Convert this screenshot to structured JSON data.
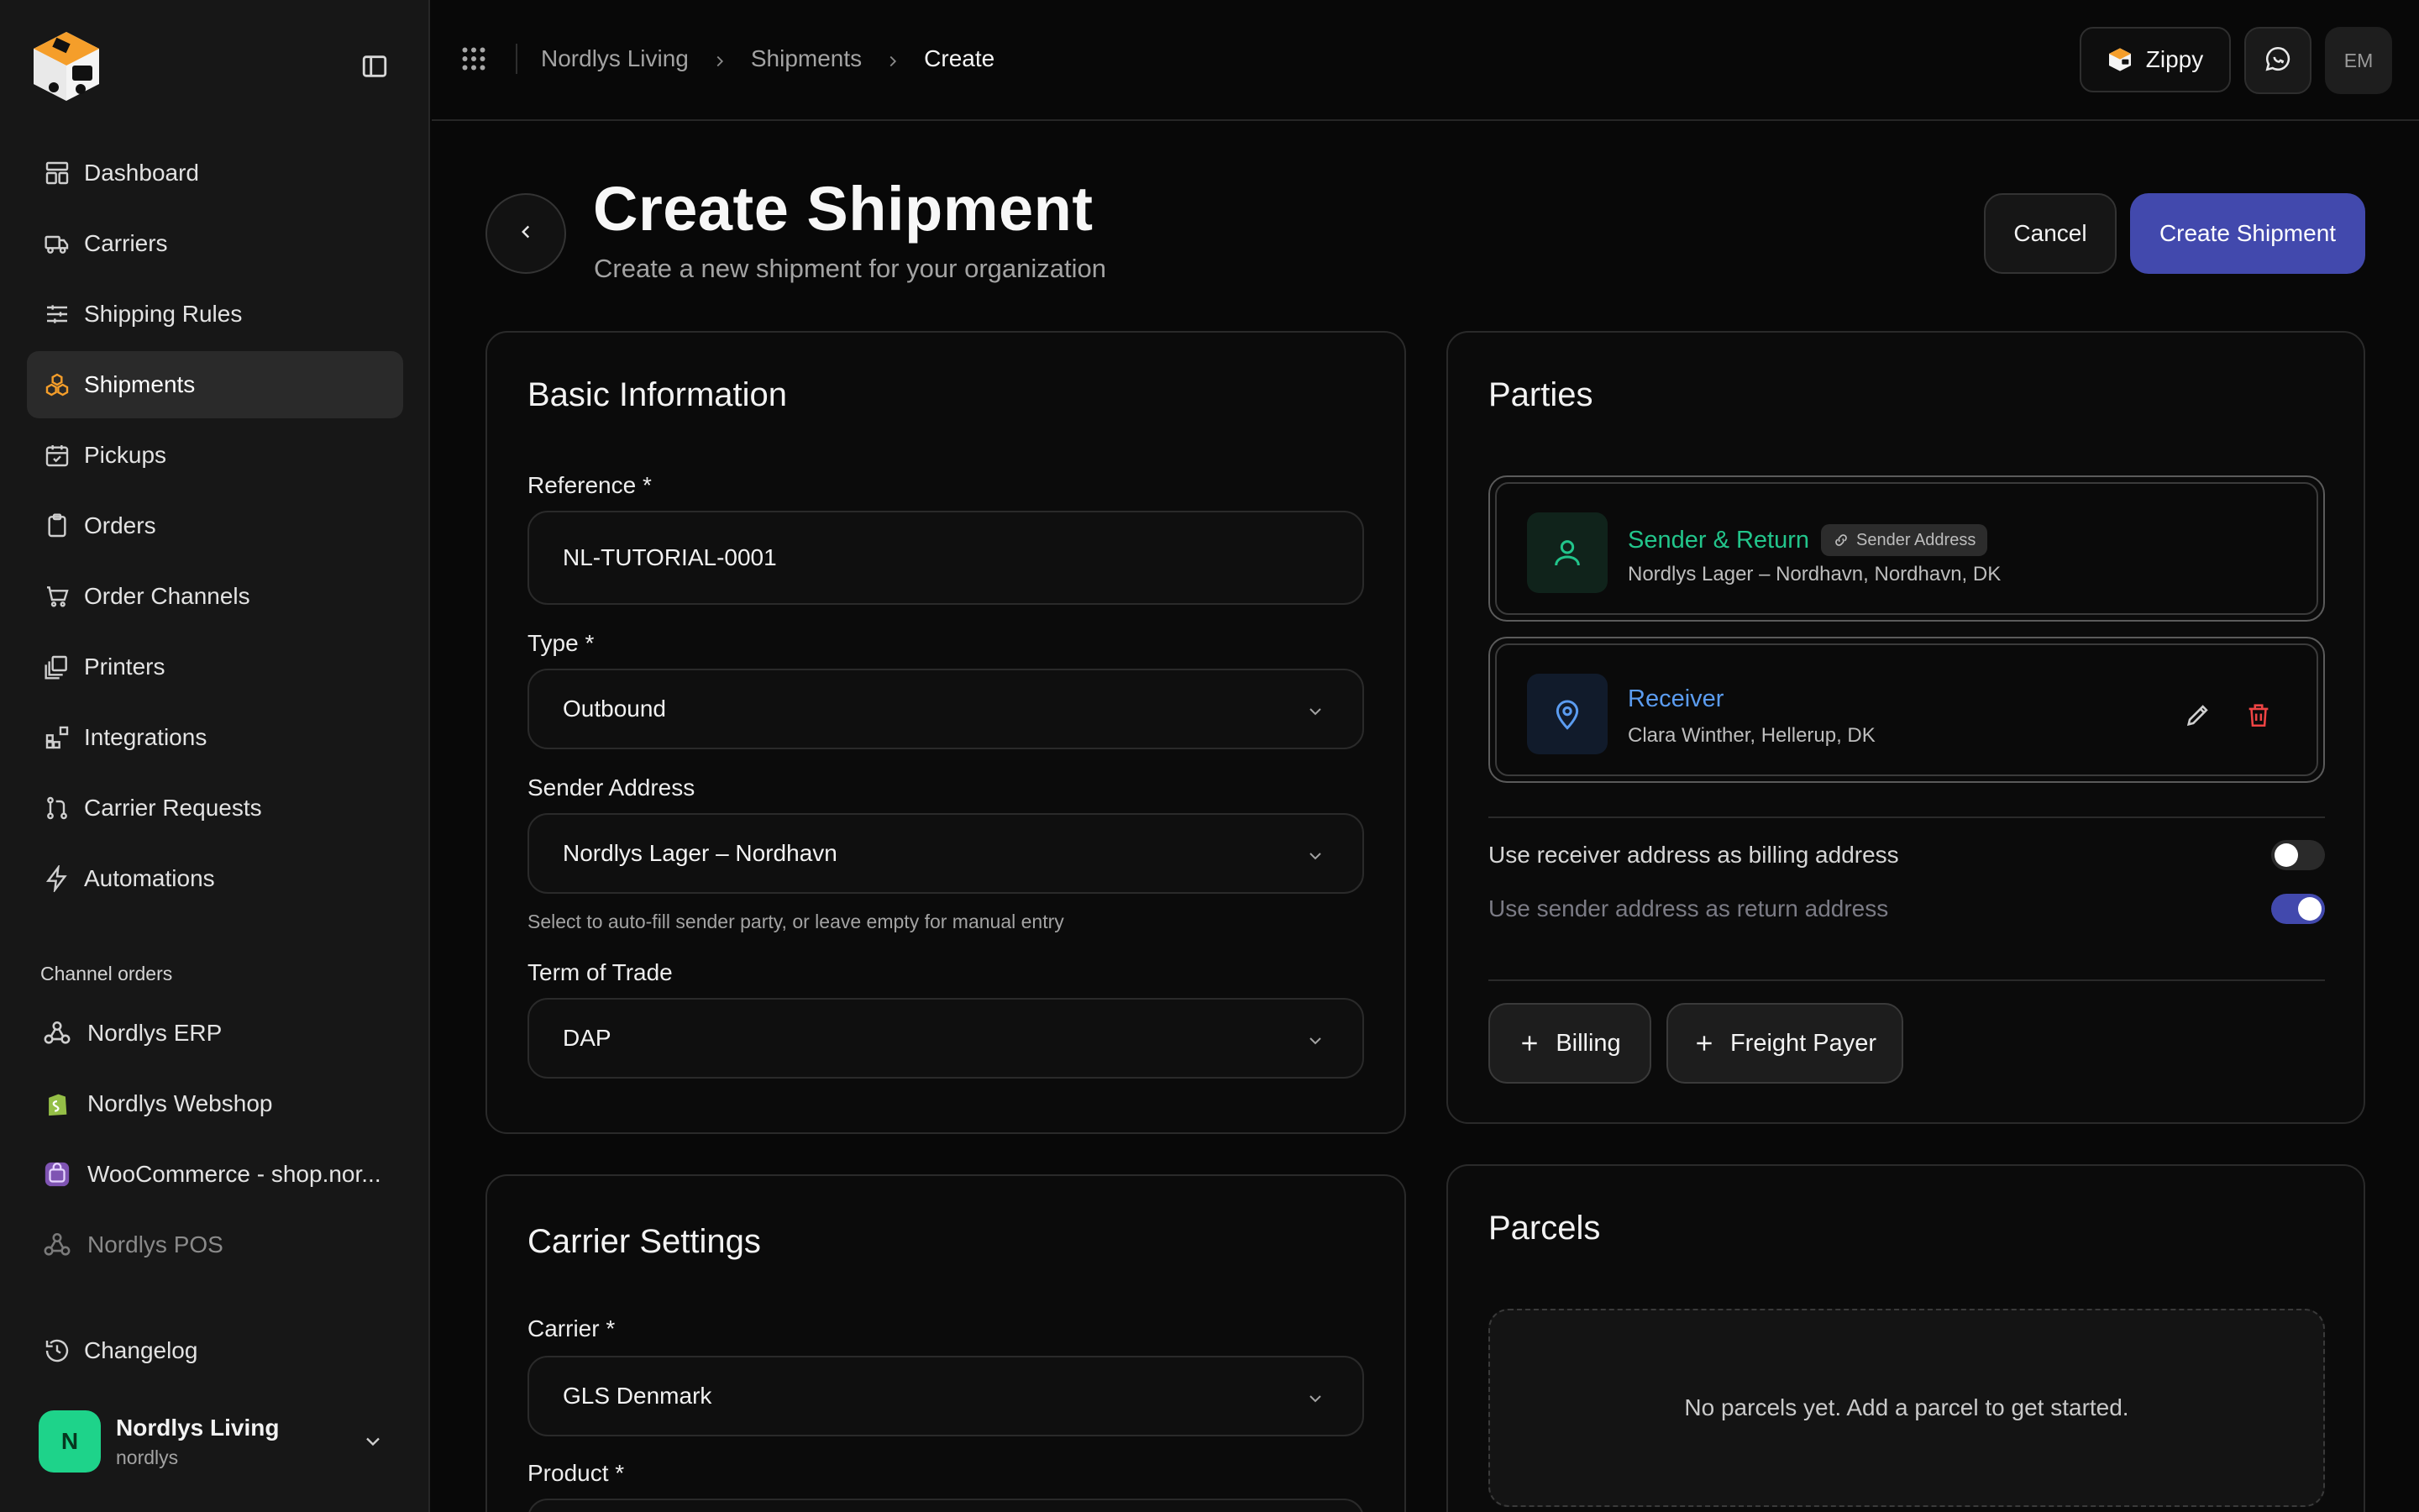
{
  "sidebar": {
    "nav": [
      {
        "label": "Dashboard",
        "icon": "dashboard-icon"
      },
      {
        "label": "Carriers",
        "icon": "truck-icon"
      },
      {
        "label": "Shipping Rules",
        "icon": "sliders-icon"
      },
      {
        "label": "Shipments",
        "icon": "boxes-icon",
        "active": true
      },
      {
        "label": "Pickups",
        "icon": "calendar-check-icon"
      },
      {
        "label": "Orders",
        "icon": "clipboard-icon"
      },
      {
        "label": "Order Channels",
        "icon": "cart-icon"
      },
      {
        "label": "Printers",
        "icon": "printer-icon"
      },
      {
        "label": "Integrations",
        "icon": "blocks-icon"
      },
      {
        "label": "Carrier Requests",
        "icon": "git-pull-icon"
      },
      {
        "label": "Automations",
        "icon": "lightning-icon"
      }
    ],
    "section_label": "Channel orders",
    "channels": [
      {
        "label": "Nordlys ERP",
        "icon": "webhook-icon"
      },
      {
        "label": "Nordlys Webshop",
        "icon": "shopify-icon"
      },
      {
        "label": "WooCommerce - shop.nor...",
        "icon": "woocommerce-icon"
      },
      {
        "label": "Nordlys POS",
        "icon": "webhook-icon"
      }
    ],
    "changelog": "Changelog",
    "org": {
      "initial": "N",
      "name": "Nordlys Living",
      "slug": "nordlys"
    }
  },
  "topbar": {
    "breadcrumbs": [
      "Nordlys Living",
      "Shipments",
      "Create"
    ],
    "zippy_label": "Zippy",
    "user_initials": "EM"
  },
  "header": {
    "title": "Create Shipment",
    "subtitle": "Create a new shipment for your organization",
    "cancel_label": "Cancel",
    "create_label": "Create Shipment"
  },
  "basic": {
    "title": "Basic Information",
    "reference_label": "Reference *",
    "reference_value": "NL-TUTORIAL-0001",
    "type_label": "Type *",
    "type_value": "Outbound",
    "sender_label": "Sender Address",
    "sender_value": "Nordlys Lager – Nordhavn",
    "sender_hint": "Select to auto-fill sender party, or leave empty for manual entry",
    "term_label": "Term of Trade",
    "term_value": "DAP"
  },
  "carrier": {
    "title": "Carrier Settings",
    "carrier_label": "Carrier *",
    "carrier_value": "GLS Denmark",
    "product_label": "Product *"
  },
  "parties": {
    "title": "Parties",
    "sender": {
      "title": "Sender & Return",
      "tag": "Sender Address",
      "desc": "Nordlys Lager – Nordhavn, Nordhavn, DK"
    },
    "receiver": {
      "title": "Receiver",
      "desc": "Clara Winther, Hellerup, DK"
    },
    "toggle_billing": {
      "label": "Use receiver address as billing address",
      "on": false
    },
    "toggle_return": {
      "label": "Use sender address as return address",
      "on": true
    },
    "billing_label": "Billing",
    "freight_label": "Freight Payer"
  },
  "parcels": {
    "title": "Parcels",
    "empty": "No parcels yet. Add a parcel to get started."
  },
  "colors": {
    "accent": "#4249ad",
    "brand_orange": "#f59e2a",
    "sender_green": "#22c58b",
    "receiver_blue": "#5b9cf0",
    "danger": "#ef4444"
  }
}
